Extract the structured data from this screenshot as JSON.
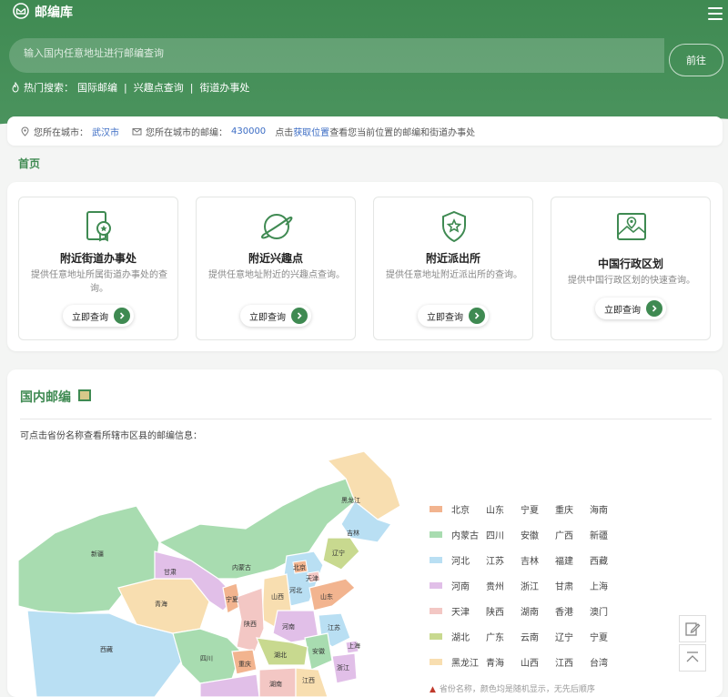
{
  "app": {
    "title": "邮编库"
  },
  "search": {
    "placeholder": "输入国内任意地址进行邮编查询",
    "button_label": "前往"
  },
  "hot_search": {
    "label": "热门搜索：",
    "links": [
      "国际邮编",
      "兴趣点查询",
      "街道办事处"
    ]
  },
  "location": {
    "city_label": "您所在城市：",
    "city": "武汉市",
    "postcode_label": "您所在城市的邮编：",
    "postcode": "430000",
    "hint_prefix": "点击",
    "hint_link": "获取位置",
    "hint_suffix": "查看您当前位置的邮编和街道办事处"
  },
  "breadcrumb": {
    "home": "首页"
  },
  "cards": [
    {
      "title": "附近街道办事处",
      "desc": "提供任意地址所属街道办事处的查询。",
      "button": "立即查询",
      "icon": "document-badge-icon"
    },
    {
      "title": "附近兴趣点",
      "desc": "提供任意地址附近的兴趣点查询。",
      "button": "立即查询",
      "icon": "planet-icon"
    },
    {
      "title": "附近派出所",
      "desc": "提供任意地址附近派出所的查询。",
      "button": "立即查询",
      "icon": "shield-star-icon"
    },
    {
      "title": "中国行政区划",
      "desc": "提供中国行政区划的快速查询。",
      "button": "立即查询",
      "icon": "map-pin-icon"
    }
  ],
  "postal": {
    "title": "国内邮编",
    "intro": "可点击省份名称查看所辖市区县的邮编信息：",
    "map_labels": [
      "黑龙江",
      "吉林",
      "辽宁",
      "北京",
      "天津",
      "河北",
      "内蒙古",
      "新疆",
      "甘肃",
      "宁夏",
      "山西",
      "山东",
      "青海",
      "陕西",
      "河南",
      "江苏",
      "西藏",
      "四川",
      "湖北",
      "安徽",
      "上海",
      "重庆",
      "湖南",
      "江西",
      "浙江"
    ],
    "legend": [
      {
        "color": "#f2b48f",
        "items": [
          "北京",
          "山东",
          "宁夏",
          "重庆",
          "海南"
        ]
      },
      {
        "color": "#a8dcb0",
        "items": [
          "内蒙古",
          "四川",
          "安徽",
          "广西",
          "新疆"
        ]
      },
      {
        "color": "#b9dff3",
        "items": [
          "河北",
          "江苏",
          "吉林",
          "福建",
          "西藏"
        ]
      },
      {
        "color": "#e1bfe8",
        "items": [
          "河南",
          "贵州",
          "浙江",
          "甘肃",
          "上海"
        ]
      },
      {
        "color": "#f3c7c4",
        "items": [
          "天津",
          "陕西",
          "湖南",
          "香港",
          "澳门"
        ]
      },
      {
        "color": "#c8d98f",
        "items": [
          "湖北",
          "广东",
          "云南",
          "辽宁",
          "宁夏"
        ]
      },
      {
        "color": "#f8deb0",
        "items": [
          "黑龙江",
          "青海",
          "山西",
          "江西",
          "台湾"
        ]
      }
    ],
    "note": "省份名称，颜色均是随机显示，无先后顺序"
  },
  "colors": {
    "brand": "#3f8a52",
    "link": "#3b6cc4"
  }
}
